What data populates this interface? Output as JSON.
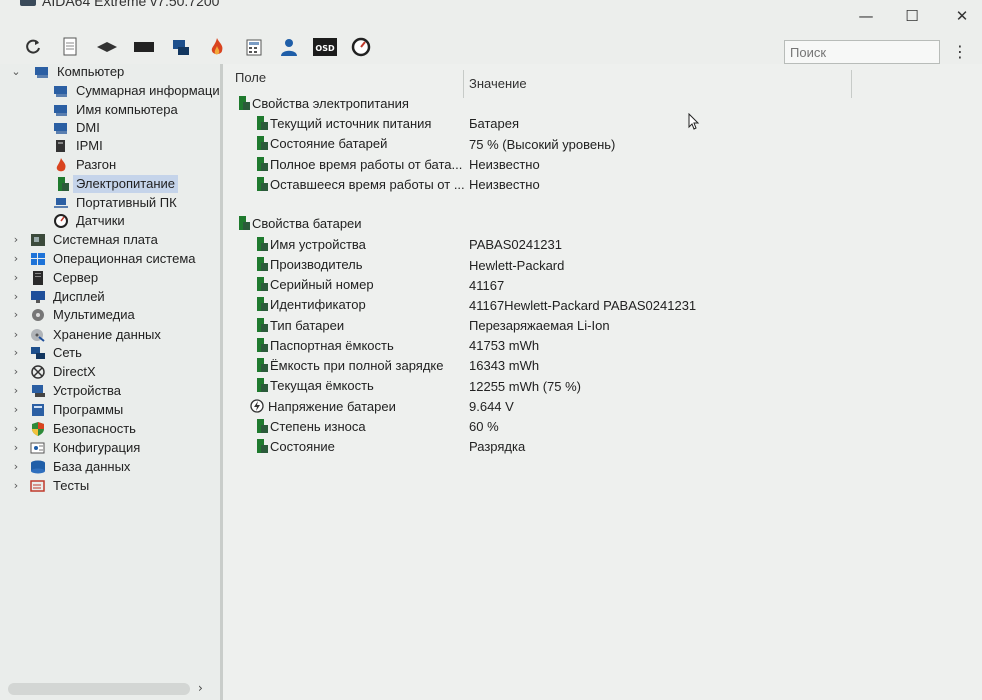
{
  "window": {
    "title": "AIDA64 Extreme v7.50.7200",
    "minimize": "—",
    "maximize": "☐",
    "close": "✕"
  },
  "toolbar": {
    "icons": [
      "refresh-icon",
      "report-icon",
      "benchmark-icon",
      "monitor-icon",
      "network-icon",
      "flame-icon",
      "calculator-icon",
      "user-icon",
      "osd-icon",
      "gauge-icon"
    ],
    "osd_label": "OSD",
    "search_placeholder": "Поиск",
    "more": "⋮"
  },
  "tree": {
    "items": [
      {
        "label": "Компьютер",
        "icon": "computer-icon",
        "expanded": true
      },
      {
        "label": "Суммарная информация",
        "icon": "computer-icon"
      },
      {
        "label": "Имя компьютера",
        "icon": "computer-icon"
      },
      {
        "label": "DMI",
        "icon": "computer-icon"
      },
      {
        "label": "IPMI",
        "icon": "ipmi-icon"
      },
      {
        "label": "Разгон",
        "icon": "flame-icon"
      },
      {
        "label": "Электропитание",
        "icon": "battery-icon",
        "selected": true
      },
      {
        "label": "Портативный ПК",
        "icon": "laptop-icon"
      },
      {
        "label": "Датчики",
        "icon": "gauge-icon"
      },
      {
        "label": "Системная плата",
        "icon": "motherboard-icon"
      },
      {
        "label": "Операционная система",
        "icon": "windows-icon"
      },
      {
        "label": "Сервер",
        "icon": "server-icon"
      },
      {
        "label": "Дисплей",
        "icon": "display-icon"
      },
      {
        "label": "Мультимедиа",
        "icon": "multimedia-icon"
      },
      {
        "label": "Хранение данных",
        "icon": "storage-icon"
      },
      {
        "label": "Сеть",
        "icon": "network-icon"
      },
      {
        "label": "DirectX",
        "icon": "directx-icon"
      },
      {
        "label": "Устройства",
        "icon": "devices-icon"
      },
      {
        "label": "Программы",
        "icon": "programs-icon"
      },
      {
        "label": "Безопасность",
        "icon": "shield-icon"
      },
      {
        "label": "Конфигурация",
        "icon": "config-icon"
      },
      {
        "label": "База данных",
        "icon": "database-icon"
      },
      {
        "label": "Тесты",
        "icon": "tests-icon"
      }
    ]
  },
  "table": {
    "col_field": "Поле",
    "col_value": "Значение",
    "sections": [
      {
        "title": "Свойства электропитания",
        "rows": [
          {
            "field": "Текущий источник питания",
            "value": "Батарея"
          },
          {
            "field": "Состояние батарей",
            "value": "75 % (Высокий уровень)"
          },
          {
            "field": "Полное время работы от бата...",
            "value": "Неизвестно"
          },
          {
            "field": "Оставшееся время работы от ...",
            "value": "Неизвестно"
          }
        ]
      },
      {
        "title": "Свойства батареи",
        "rows": [
          {
            "field": "Имя устройства",
            "value": "PABAS0241231"
          },
          {
            "field": "Производитель",
            "value": "Hewlett-Packard"
          },
          {
            "field": "Серийный номер",
            "value": "41167"
          },
          {
            "field": "Идентификатор",
            "value": "41167Hewlett-Packard PABAS0241231"
          },
          {
            "field": "Тип батареи",
            "value": "Перезаряжаемая Li-Ion"
          },
          {
            "field": "Паспортная ёмкость",
            "value": "41753 mWh"
          },
          {
            "field": "Ёмкость при полной зарядке",
            "value": "16343 mWh"
          },
          {
            "field": "Текущая ёмкость",
            "value": "12255 mWh  (75 %)"
          },
          {
            "field": "Напряжение батареи",
            "value": "9.644 V",
            "icon": "voltage-icon"
          },
          {
            "field": "Степень износа",
            "value": "60 %"
          },
          {
            "field": "Состояние",
            "value": "Разрядка"
          }
        ]
      }
    ]
  }
}
